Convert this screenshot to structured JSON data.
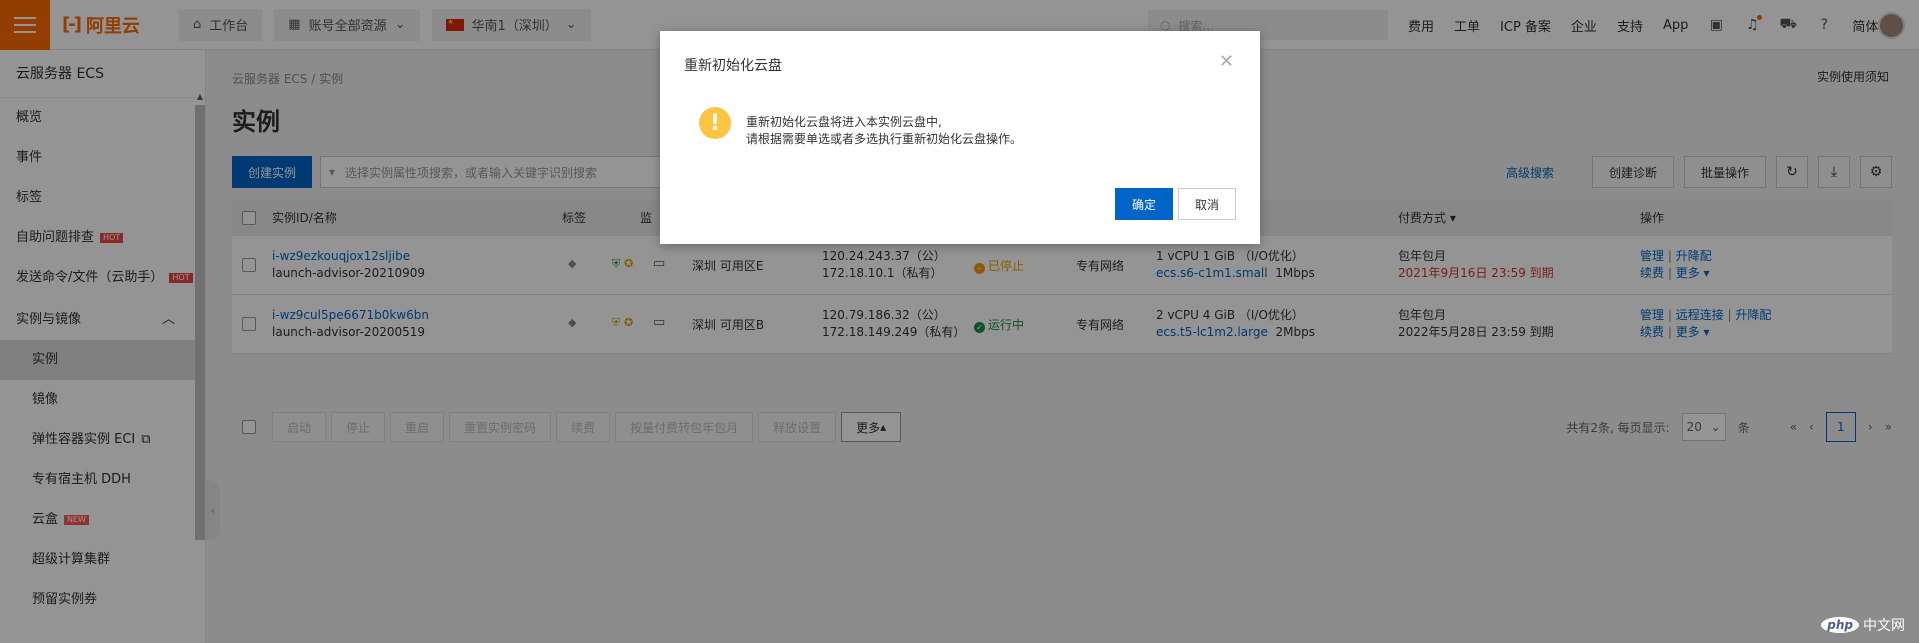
{
  "topbar": {
    "logo_text": "阿里云",
    "workbench": "工作台",
    "resources": "账号全部资源",
    "region": "华南1（深圳）",
    "search_placeholder": "搜索...",
    "links": [
      "费用",
      "工单",
      "ICP 备案",
      "企业",
      "支持",
      "App"
    ],
    "lang": "简体"
  },
  "sidebar": {
    "title": "云服务器 ECS",
    "items": [
      {
        "label": "概览"
      },
      {
        "label": "事件"
      },
      {
        "label": "标签"
      },
      {
        "label": "自助问题排查",
        "badge": "HOT"
      },
      {
        "label": "发送命令/文件（云助手）",
        "badge": "HOT"
      }
    ],
    "group": "实例与镜像",
    "sub_items": [
      {
        "label": "实例"
      },
      {
        "label": "镜像"
      },
      {
        "label": "弹性容器实例 ECI"
      },
      {
        "label": "专有宿主机 DDH"
      },
      {
        "label": "云盒",
        "badge": "NEW"
      },
      {
        "label": "超级计算集群"
      },
      {
        "label": "预留实例券"
      }
    ]
  },
  "main": {
    "breadcrumb": "云服务器 ECS / 实例",
    "usage_note": "实例使用须知",
    "title": "实例",
    "create_btn": "创建实例",
    "filter_placeholder": "选择实例属性项搜索，或者输入关键字识别搜索",
    "advanced_search": "高级搜索",
    "create_diagnosis": "创建诊断",
    "batch_ops": "批量操作"
  },
  "table": {
    "headers": {
      "id": "实例ID/名称",
      "tag": "标签",
      "mon": "监",
      "pay": "付费方式",
      "ops": "操作"
    },
    "rows": [
      {
        "id": "i-wz9ezkouqjox12sljibe",
        "name": "launch-advisor-20210909",
        "zone": "深圳 可用区E",
        "ip_pub": "120.24.243.37（公）",
        "ip_priv": "172.18.10.1（私有）",
        "status": "已停止",
        "network": "专有网络",
        "spec": "1 vCPU 1 GiB （I/O优化）",
        "type": "ecs.s6-c1m1.small",
        "bw": "1Mbps",
        "pay": "包年包月",
        "expire": "2021年9月16日 23:59 到期",
        "ops": [
          "管理",
          "升降配",
          "续费",
          "更多"
        ]
      },
      {
        "id": "i-wz9cul5pe6671b0kw6bn",
        "name": "launch-advisor-20200519",
        "zone": "深圳 可用区B",
        "ip_pub": "120.79.186.32（公）",
        "ip_priv": "172.18.149.249（私有）",
        "status": "运行中",
        "network": "专有网络",
        "spec": "2 vCPU 4 GiB （I/O优化）",
        "type": "ecs.t5-lc1m2.large",
        "bw": "2Mbps",
        "pay": "包年包月",
        "expire": "2022年5月28日 23:59 到期",
        "ops": [
          "管理",
          "远程连接",
          "升降配",
          "续费",
          "更多"
        ]
      }
    ]
  },
  "bottom": {
    "buttons": [
      "启动",
      "停止",
      "重启",
      "重置实例密码",
      "续费",
      "按量付费转包年包月",
      "释放设置"
    ],
    "more": "更多",
    "total": "共有2条, 每页显示:",
    "page_size": "20",
    "unit": "条",
    "current_page": "1"
  },
  "dialog": {
    "title": "重新初始化云盘",
    "line1": "重新初始化云盘将进入本实例云盘中,",
    "line2": "请根据需要单选或者多选执行重新初始化云盘操作。",
    "ok": "确定",
    "cancel": "取消"
  },
  "watermark": {
    "logo": "php",
    "text": "中文网"
  }
}
